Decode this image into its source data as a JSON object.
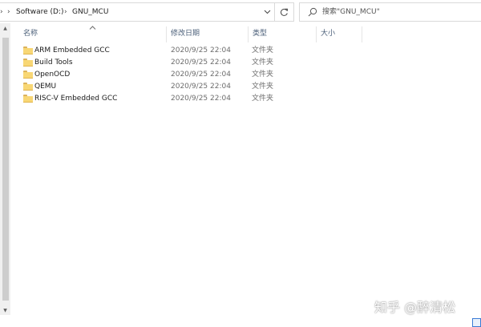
{
  "address_bar": {
    "segments": [
      "Software (D:)",
      "GNU_MCU"
    ]
  },
  "search": {
    "placeholder": "搜索\"GNU_MCU\""
  },
  "columns": {
    "name": "名称",
    "date": "修改日期",
    "type": "类型",
    "size": "大小"
  },
  "files": [
    {
      "name": "ARM Embedded GCC",
      "date": "2020/9/25 22:04",
      "type": "文件夹"
    },
    {
      "name": "Build Tools",
      "date": "2020/9/25 22:04",
      "type": "文件夹"
    },
    {
      "name": "OpenOCD",
      "date": "2020/9/25 22:04",
      "type": "文件夹"
    },
    {
      "name": "QEMU",
      "date": "2020/9/25 22:04",
      "type": "文件夹"
    },
    {
      "name": "RISC-V Embedded GCC",
      "date": "2020/9/25 22:04",
      "type": "文件夹"
    }
  ],
  "watermark": "知乎 @醉清松",
  "icons": {
    "folder": "folder-icon",
    "search": "search-icon",
    "refresh": "refresh-icon",
    "dropdown": "chevron-down-icon",
    "sort": "sort-up-icon"
  },
  "colors": {
    "header_text": "#4c607a",
    "folder_yellow": "#f8d775",
    "muted_text": "#6d6d6d"
  }
}
